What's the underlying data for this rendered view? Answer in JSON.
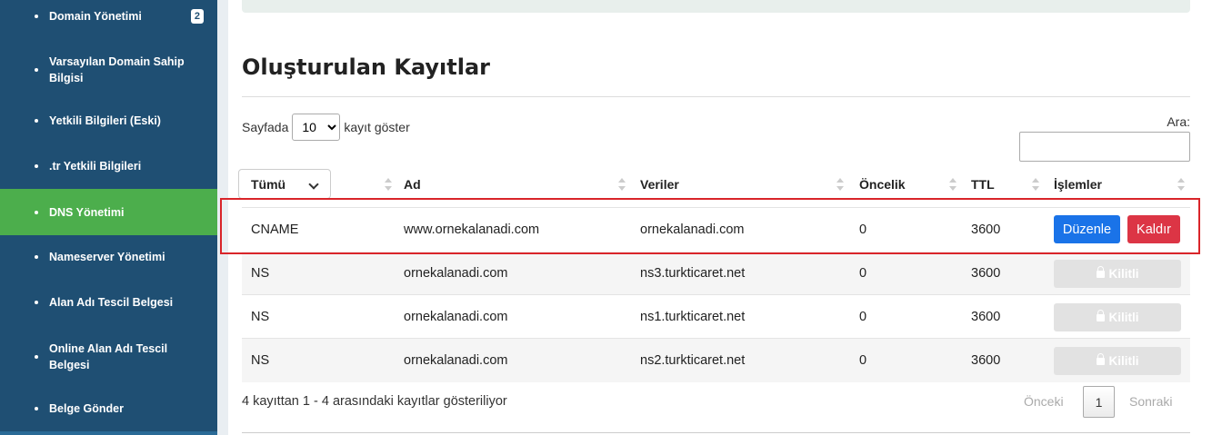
{
  "sidebar": {
    "items": [
      {
        "label": "Domain Yönetimi",
        "badge": "2"
      },
      {
        "label": "Varsayılan Domain Sahip Bilgisi"
      },
      {
        "label": "Yetkili Bilgileri (Eski)"
      },
      {
        "label": ".tr Yetkili Bilgileri"
      },
      {
        "label": "DNS Yönetimi",
        "active": true
      },
      {
        "label": "Nameserver Yönetimi"
      },
      {
        "label": "Alan Adı Tescil Belgesi"
      },
      {
        "label": "Online Alan Adı Tescil Belgesi"
      },
      {
        "label": "Belge Gönder"
      }
    ],
    "active_color": "#4cae4c",
    "bg_color": "#1f4f73"
  },
  "main": {
    "title": "Oluşturulan Kayıtlar",
    "length": {
      "prefix": "Sayfada",
      "value": "10",
      "suffix": "kayıt göster"
    },
    "search": {
      "label": "Ara:",
      "value": ""
    },
    "table": {
      "filter": "Tümü",
      "headers": [
        "Ad",
        "Veriler",
        "Öncelik",
        "TTL",
        "İşlemler"
      ],
      "rows": [
        {
          "type": "CNAME",
          "name": "www.ornekalanadi.com",
          "data": "ornekalanadi.com",
          "priority": "0",
          "ttl": "3600",
          "edit": "Düzenle",
          "delete": "Kaldır"
        },
        {
          "type": "NS",
          "name": "ornekalanadi.com",
          "data": "ns3.turkticaret.net",
          "priority": "0",
          "ttl": "3600",
          "locked": "Kilitli"
        },
        {
          "type": "NS",
          "name": "ornekalanadi.com",
          "data": "ns1.turkticaret.net",
          "priority": "0",
          "ttl": "3600",
          "locked": "Kilitli"
        },
        {
          "type": "NS",
          "name": "ornekalanadi.com",
          "data": "ns2.turkticaret.net",
          "priority": "0",
          "ttl": "3600",
          "locked": "Kilitli"
        }
      ]
    },
    "info": "4 kayıttan 1 - 4 arasındaki kayıtlar gösteriliyor",
    "pagination": {
      "prev": "Önceki",
      "page": "1",
      "next": "Sonraki"
    },
    "highlight_color": "#d9252a"
  }
}
